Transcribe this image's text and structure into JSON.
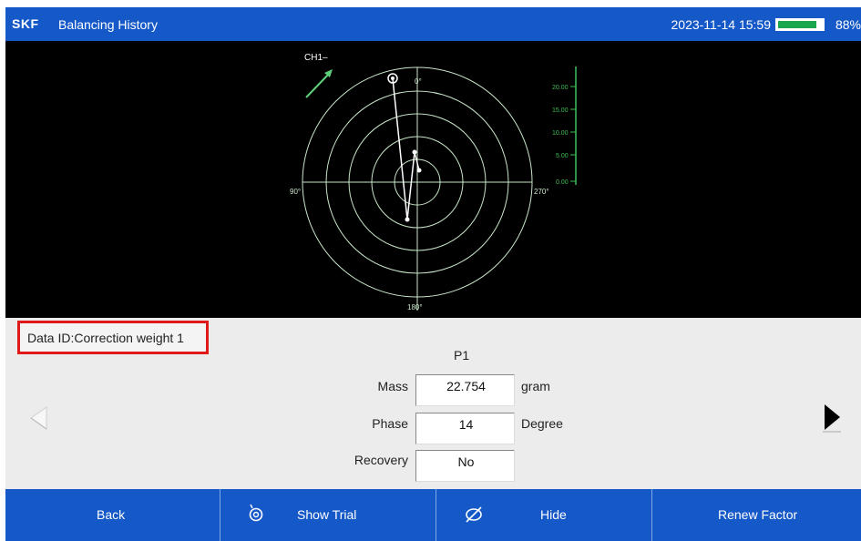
{
  "header": {
    "logo": "SKF",
    "title": "Balancing History",
    "datetime": "2023-11-14 15:59",
    "battery_percent": "88%",
    "battery_level": 0.88
  },
  "plot": {
    "channel_label": "CH1–",
    "angles": {
      "top": "0°",
      "left": "90°",
      "right": "270°",
      "bottom": "180°"
    },
    "scale_ticks": [
      "20.00",
      "15.00",
      "10.00",
      "5.00",
      "0.00"
    ],
    "colors": {
      "grid": "#c9e6c9",
      "scale": "#3fbf55",
      "vector": "#ffffff",
      "arrow": "#5fd07a"
    }
  },
  "info": {
    "data_id": "Data ID:Correction weight 1",
    "point": "P1",
    "fields": [
      {
        "label": "Mass",
        "value": "22.754",
        "unit": "gram"
      },
      {
        "label": "Phase",
        "value": "14",
        "unit": "Degree"
      },
      {
        "label": "Recovery",
        "value": "No",
        "unit": ""
      }
    ]
  },
  "toolbar": {
    "back": "Back",
    "show_trial": "Show Trial",
    "hide": "Hide",
    "renew_factor": "Renew Factor"
  }
}
